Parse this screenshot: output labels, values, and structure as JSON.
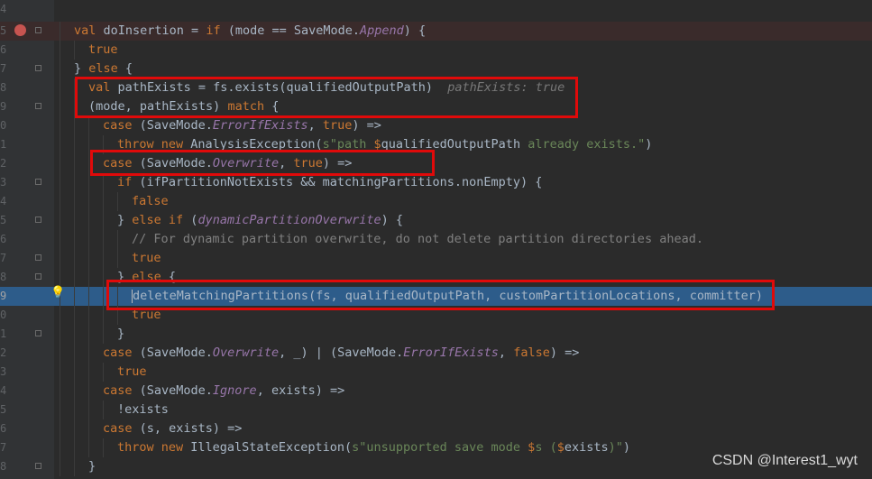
{
  "editor": {
    "lines": [
      {
        "num": "4",
        "tokens": []
      },
      {
        "num": "5",
        "highlight": "red",
        "tokens": [
          {
            "t": "val ",
            "c": "kw"
          },
          {
            "t": "doInsertion = ",
            "c": "id"
          },
          {
            "t": "if ",
            "c": "kw"
          },
          {
            "t": "(mode == SaveMode.",
            "c": "id"
          },
          {
            "t": "Append",
            "c": "it"
          },
          {
            "t": ") {",
            "c": "id"
          }
        ]
      },
      {
        "num": "6",
        "tokens": [
          {
            "t": "true",
            "c": "kw"
          }
        ]
      },
      {
        "num": "7",
        "tokens": [
          {
            "t": "} ",
            "c": "id"
          },
          {
            "t": "else ",
            "c": "kw"
          },
          {
            "t": "{",
            "c": "id"
          }
        ]
      },
      {
        "num": "8",
        "tokens": [
          {
            "t": "val ",
            "c": "kw"
          },
          {
            "t": "pathExists = fs.exists(qualifiedOutputPath)  ",
            "c": "id"
          },
          {
            "t": "pathExists: true",
            "c": "hint"
          }
        ]
      },
      {
        "num": "9",
        "tokens": [
          {
            "t": "(mode, pathExists) ",
            "c": "id"
          },
          {
            "t": "match ",
            "c": "kw"
          },
          {
            "t": "{",
            "c": "id"
          }
        ]
      },
      {
        "num": "0",
        "tokens": [
          {
            "t": "case ",
            "c": "kw"
          },
          {
            "t": "(SaveMode.",
            "c": "id"
          },
          {
            "t": "ErrorIfExists",
            "c": "it"
          },
          {
            "t": ", ",
            "c": "id"
          },
          {
            "t": "true",
            "c": "kw"
          },
          {
            "t": ") =>",
            "c": "id"
          }
        ]
      },
      {
        "num": "1",
        "tokens": [
          {
            "t": "throw new ",
            "c": "kw"
          },
          {
            "t": "AnalysisException(",
            "c": "id"
          },
          {
            "t": "s\"path ",
            "c": "str"
          },
          {
            "t": "$",
            "c": "kw"
          },
          {
            "t": "qualifiedOutputPath",
            "c": "id"
          },
          {
            "t": " already exists.\"",
            "c": "str"
          },
          {
            "t": ")",
            "c": "id"
          }
        ]
      },
      {
        "num": "2",
        "tokens": [
          {
            "t": "case ",
            "c": "kw"
          },
          {
            "t": "(SaveMode.",
            "c": "id"
          },
          {
            "t": "Overwrite",
            "c": "it"
          },
          {
            "t": ", ",
            "c": "id"
          },
          {
            "t": "true",
            "c": "kw"
          },
          {
            "t": ") =>",
            "c": "id"
          }
        ]
      },
      {
        "num": "3",
        "tokens": [
          {
            "t": "if ",
            "c": "kw"
          },
          {
            "t": "(ifPartitionNotExists && matchingPartitions.nonEmpty) {",
            "c": "id"
          }
        ]
      },
      {
        "num": "4",
        "tokens": [
          {
            "t": "false",
            "c": "kw"
          }
        ]
      },
      {
        "num": "5",
        "tokens": [
          {
            "t": "} ",
            "c": "id"
          },
          {
            "t": "else if ",
            "c": "kw"
          },
          {
            "t": "(",
            "c": "id"
          },
          {
            "t": "dynamicPartitionOverwrite",
            "c": "it"
          },
          {
            "t": ") {",
            "c": "id"
          }
        ]
      },
      {
        "num": "6",
        "tokens": [
          {
            "t": "// For dynamic partition overwrite, do not delete partition directories ahead.",
            "c": "cm"
          }
        ]
      },
      {
        "num": "7",
        "tokens": [
          {
            "t": "true",
            "c": "kw"
          }
        ]
      },
      {
        "num": "8",
        "tokens": [
          {
            "t": "} ",
            "c": "id"
          },
          {
            "t": "else ",
            "c": "kw"
          },
          {
            "t": "{",
            "c": "id"
          }
        ]
      },
      {
        "num": "9",
        "highlight": "blue",
        "caret": true,
        "tokens": [
          {
            "t": "deleteMatchingPartitions(fs, qualifiedOutputPath, customPartitionLocations, committer)",
            "c": "id"
          }
        ]
      },
      {
        "num": "0",
        "tokens": [
          {
            "t": "true",
            "c": "kw"
          }
        ]
      },
      {
        "num": "1",
        "tokens": [
          {
            "t": "}",
            "c": "id"
          }
        ]
      },
      {
        "num": "2",
        "tokens": [
          {
            "t": "case ",
            "c": "kw"
          },
          {
            "t": "(SaveMode.",
            "c": "id"
          },
          {
            "t": "Overwrite",
            "c": "it"
          },
          {
            "t": ", _) | (SaveMode.",
            "c": "id"
          },
          {
            "t": "ErrorIfExists",
            "c": "it"
          },
          {
            "t": ", ",
            "c": "id"
          },
          {
            "t": "false",
            "c": "kw"
          },
          {
            "t": ") =>",
            "c": "id"
          }
        ]
      },
      {
        "num": "3",
        "tokens": [
          {
            "t": "true",
            "c": "kw"
          }
        ]
      },
      {
        "num": "4",
        "tokens": [
          {
            "t": "case ",
            "c": "kw"
          },
          {
            "t": "(SaveMode.",
            "c": "id"
          },
          {
            "t": "Ignore",
            "c": "it"
          },
          {
            "t": ", exists) =>",
            "c": "id"
          }
        ]
      },
      {
        "num": "5",
        "tokens": [
          {
            "t": "!exists",
            "c": "id"
          }
        ]
      },
      {
        "num": "6",
        "tokens": [
          {
            "t": "case ",
            "c": "kw"
          },
          {
            "t": "(s, exists) =>",
            "c": "id"
          }
        ]
      },
      {
        "num": "7",
        "tokens": [
          {
            "t": "throw new ",
            "c": "kw"
          },
          {
            "t": "IllegalStateException(",
            "c": "id"
          },
          {
            "t": "s\"unsupported save mode ",
            "c": "str"
          },
          {
            "t": "$",
            "c": "kw"
          },
          {
            "t": "s (",
            "c": "str"
          },
          {
            "t": "$",
            "c": "kw"
          },
          {
            "t": "exists",
            "c": "id"
          },
          {
            "t": ")\"",
            "c": "str"
          },
          {
            "t": ")",
            "c": "id"
          }
        ]
      },
      {
        "num": "8",
        "tokens": [
          {
            "t": "}",
            "c": "id"
          }
        ]
      }
    ]
  },
  "watermark": "CSDN @Interest1_wyt",
  "icons": {
    "breakpoint": "breakpoint-icon",
    "bulb": "lightbulb-icon"
  }
}
